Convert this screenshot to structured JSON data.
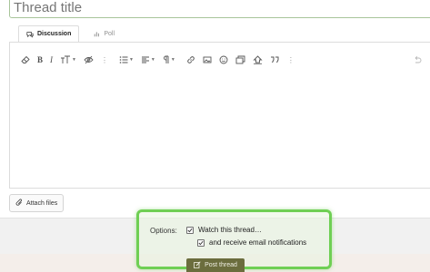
{
  "thread_title": {
    "placeholder": "Thread title",
    "value": ""
  },
  "tabs": [
    {
      "label": "Discussion",
      "icon": "discussion-icon",
      "active": true
    },
    {
      "label": "Poll",
      "icon": "poll-icon",
      "active": false
    }
  ],
  "toolbar": {
    "buttons": [
      "eraser-icon",
      "bold-icon",
      "italic-icon",
      "font-size-icon",
      "hide-icon",
      "more-icon",
      "list-icon",
      "align-icon",
      "paragraph-icon",
      "link-icon",
      "image-icon",
      "emoji-icon",
      "media-icon",
      "insert-icon",
      "quote-icon",
      "more-icon",
      "undo-icon"
    ],
    "bold": "B",
    "italic": "I",
    "sep": "⋮"
  },
  "attach": {
    "label": "Attach files"
  },
  "options": {
    "label": "Options:",
    "watch_label": "Watch this thread…",
    "watch_checked": true,
    "email_label": "and receive email notifications",
    "email_checked": true
  },
  "post": {
    "label": "Post thread"
  },
  "colors": {
    "highlight": "#6fcf54",
    "post_button": "#6b6d3d",
    "title_border": "#a8c59a"
  }
}
